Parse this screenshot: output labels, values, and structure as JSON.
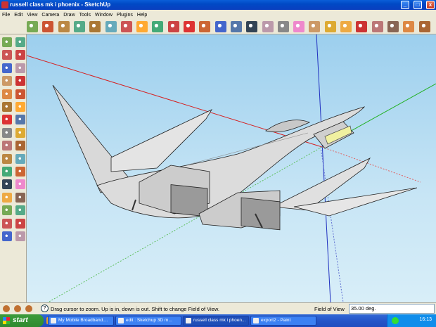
{
  "window": {
    "title": "russell class mk i phoenix - SketchUp",
    "controls": [
      "_",
      "□",
      "x"
    ]
  },
  "menu": [
    "File",
    "Edit",
    "View",
    "Camera",
    "Draw",
    "Tools",
    "Window",
    "Plugins",
    "Help"
  ],
  "toolbar_icons": [
    "select-icon",
    "pencil-icon",
    "rectangle-icon",
    "circle-icon",
    "arc-icon",
    "make-component-icon",
    "eraser-icon",
    "paint-bucket-icon",
    "push-pull-icon",
    "move-icon",
    "rotate-icon",
    "follow-me-icon",
    "orbit-icon",
    "pan-icon",
    "zoom-icon",
    "zoom-extents-icon",
    "previous-view-icon",
    "tape-measure-icon",
    "dimension-icon",
    "protractor-icon",
    "text-icon",
    "axes-icon",
    "3d-text-icon",
    "get-models-icon",
    "share-model-icon",
    "components-icon"
  ],
  "left_toolbar_icons": [
    "select-icon",
    "make-component-icon",
    "paint-bucket-icon",
    "eraser-icon",
    "rectangle-icon",
    "line-icon",
    "circle-icon",
    "arc-icon",
    "polygon-icon",
    "freehand-icon",
    "move-icon",
    "push-pull-icon",
    "rotate-icon",
    "follow-me-icon",
    "scale-icon",
    "offset-icon",
    "tape-measure-icon",
    "dimension-icon",
    "protractor-icon",
    "text-icon",
    "axes-icon",
    "3d-text-icon",
    "orbit-icon",
    "pan-icon",
    "zoom-icon",
    "zoom-window-icon",
    "previous-icon",
    "zoom-extents-icon",
    "position-camera-icon",
    "look-around-icon",
    "walk-icon",
    "section-plane-icon"
  ],
  "status": {
    "hint": "Drag cursor to zoom.  Up is in, down is out. Shift to change Field of View.",
    "vcb_label": "Field of View",
    "vcb_value": "35.00 deg."
  },
  "taskbar": {
    "start_label": "start",
    "tasks": [
      {
        "label": "My Mobile Broadband....",
        "active": false
      },
      {
        "label": "edit : Sketchup 3D m...",
        "active": false
      },
      {
        "label": "russell class mk i phoen...",
        "active": true
      },
      {
        "label": "export2 - Paint",
        "active": false
      }
    ],
    "clock": "16:13"
  },
  "colors": {
    "sky_top": "#9ccfee",
    "axis_red": "#d62020",
    "axis_green": "#22b022",
    "axis_blue": "#2030c0",
    "model_gray": "#d9d9d9"
  }
}
